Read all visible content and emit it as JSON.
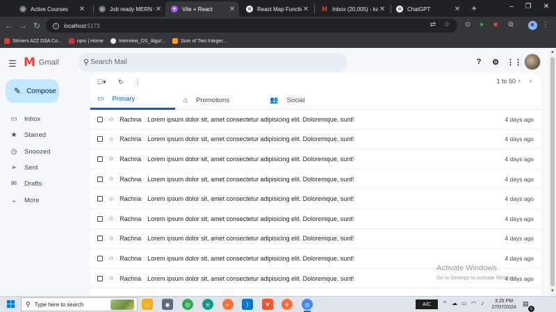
{
  "browser": {
    "tabs": [
      {
        "title": "Active Courses",
        "icon": "course-icon",
        "color": "#5f6368"
      },
      {
        "title": "Job ready MERN full-",
        "icon": "course-icon",
        "color": "#5f6368"
      },
      {
        "title": "Vite + React",
        "icon": "vite-icon",
        "color": "#a855f7"
      },
      {
        "title": "React Map Function |",
        "icon": "chatgpt-icon",
        "color": "#ffffff"
      },
      {
        "title": "Inbox (20,005) - kalk",
        "icon": "gmail-icon",
        "color": "#ea4335"
      },
      {
        "title": "ChatGPT",
        "icon": "chatgpt-icon",
        "color": "#ffffff"
      }
    ],
    "active_tab": 2,
    "new_tab": "+",
    "window_controls": [
      "–",
      "❐",
      "✕"
    ],
    "address": {
      "host": "localhost",
      "port": ":5173"
    },
    "profile_initial": "K",
    "bookmarks": [
      {
        "label": "Strivers A2Z DSA Co...",
        "icon": "tuf-icon",
        "color": "#e53935"
      },
      {
        "label": "npm | Home",
        "icon": "npm-icon",
        "color": "#cb3837"
      },
      {
        "label": "Interview_DS_Algo/...",
        "icon": "github-icon",
        "color": "#e8eaed"
      },
      {
        "label": "Sum of Two Integer...",
        "icon": "leetcode-icon",
        "color": "#ffa116"
      }
    ]
  },
  "gmail": {
    "logo_text": "Gmail",
    "search_placeholder": "Search Mail",
    "compose_label": "Compose",
    "nav": [
      {
        "label": "Inbox",
        "icon": "inbox-icon"
      },
      {
        "label": "Starred",
        "icon": "star-icon"
      },
      {
        "label": "Snoozed",
        "icon": "clock-icon"
      },
      {
        "label": "Sent",
        "icon": "send-icon"
      },
      {
        "label": "Drafts",
        "icon": "draft-icon"
      },
      {
        "label": "More",
        "icon": "chevron-down-icon"
      }
    ],
    "pagination": "1 to 50",
    "tabs": [
      {
        "label": "Primary",
        "icon": "inbox-icon"
      },
      {
        "label": "Promotions",
        "icon": "tag-icon"
      },
      {
        "label": "Social",
        "icon": "people-icon"
      }
    ],
    "active_tab": 0,
    "emails": [
      {
        "sender": "Rachna",
        "subject": "Lorem ipsum dolor sit, amet consectetur adipisicing elit. Doloremque, sunt!",
        "date": "4 days ago"
      },
      {
        "sender": "Rachna",
        "subject": "Lorem ipsum dolor sit, amet consectetur adipisicing elit. Doloremque, sunt!",
        "date": "4 days ago"
      },
      {
        "sender": "Rachna",
        "subject": "Lorem ipsum dolor sit, amet consectetur adipisicing elit. Doloremque, sunt!",
        "date": "4 days ago"
      },
      {
        "sender": "Rachna",
        "subject": "Lorem ipsum dolor sit, amet consectetur adipisicing elit. Doloremque, sunt!",
        "date": "4 days ago"
      },
      {
        "sender": "Rachna",
        "subject": "Lorem ipsum dolor sit, amet consectetur adipisicing elit. Doloremque, sunt!",
        "date": "4 days ago"
      },
      {
        "sender": "Rachna",
        "subject": "Lorem ipsum dolor sit, amet consectetur adipisicing elit. Doloremque, sunt!",
        "date": "4 days ago"
      },
      {
        "sender": "Rachna",
        "subject": "Lorem ipsum dolor sit, amet consectetur adipisicing elit. Doloremque, sunt!",
        "date": "4 days ago"
      },
      {
        "sender": "Rachna",
        "subject": "Lorem ipsum dolor sit, amet consectetur adipisicing elit. Doloremque, sunt!",
        "date": "4 days ago"
      },
      {
        "sender": "Rachna",
        "subject": "Lorem ipsum dolor sit, amet consectetur adipisicing elit. Doloremque, sunt!",
        "date": "4 days ago"
      }
    ]
  },
  "watermark": {
    "line1": "Activate Windows",
    "line2": "Go to Settings to activate Windows."
  },
  "taskbar": {
    "search_placeholder": "Type here to search",
    "apps": [
      {
        "icon": "file-explorer-icon",
        "color": "#f2b01e"
      },
      {
        "icon": "camera-icon",
        "color": "#5f6b7a"
      },
      {
        "icon": "chrome-icon",
        "color": "#34a853"
      },
      {
        "icon": "edge-icon",
        "color": "#0f9d8a"
      },
      {
        "icon": "firefox-icon",
        "color": "#ff7139"
      },
      {
        "icon": "vscode-icon",
        "color": "#007acc"
      },
      {
        "icon": "brave-icon",
        "color": "#fb542b"
      },
      {
        "icon": "postman-icon",
        "color": "#ff6c37"
      },
      {
        "icon": "chrome-icon",
        "color": "#4285f4"
      }
    ],
    "keyboard": "A/C",
    "time": "3:25 PM",
    "date": "27/07/2024",
    "notification_count": "5"
  }
}
